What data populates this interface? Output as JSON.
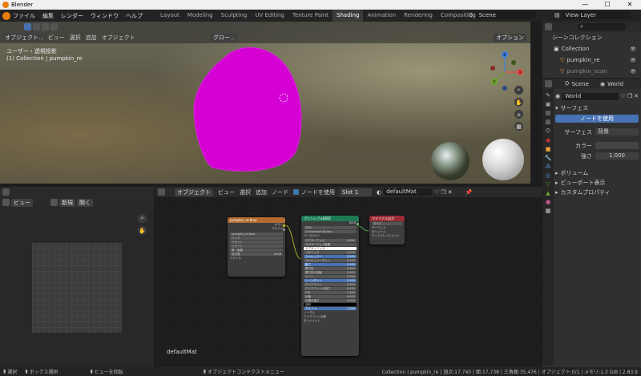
{
  "window": {
    "title": "Blender",
    "min": "—",
    "max": "☐",
    "close": "✕"
  },
  "menu": [
    "ファイル",
    "編集",
    "レンダー",
    "ウィンドウ",
    "ヘルプ"
  ],
  "workspaces": [
    {
      "label": "Layout",
      "active": false
    },
    {
      "label": "Modeling",
      "active": false
    },
    {
      "label": "Sculpting",
      "active": false
    },
    {
      "label": "UV Editing",
      "active": false
    },
    {
      "label": "Texture Paint",
      "active": false
    },
    {
      "label": "Shading",
      "active": true
    },
    {
      "label": "Animation",
      "active": false
    },
    {
      "label": "Rendering",
      "active": false
    },
    {
      "label": "Compositing",
      "active": false
    },
    {
      "label": "Scripting",
      "active": false
    }
  ],
  "scene": {
    "label": "Scene"
  },
  "view_layer": {
    "label": "View Layer"
  },
  "viewport": {
    "mode": "オブジェクト...",
    "menus": [
      "ビュー",
      "選択",
      "追加",
      "オブジェクト"
    ],
    "transform": "グロー...",
    "overlay_label": "オプション",
    "info_line1": "ユーザー・透視投影",
    "info_line2": "(1) Collection | pumpkin_re",
    "gizmo": {
      "z": "Z",
      "y": "Y",
      "x": "X"
    }
  },
  "outliner": {
    "search_placeholder": "",
    "root": "シーンコレクション",
    "items": [
      {
        "label": "Collection",
        "level": 1
      },
      {
        "label": "pumpkin_re",
        "level": 2
      },
      {
        "label": "pumpkin_scan",
        "level": 2
      }
    ]
  },
  "properties": {
    "tab_scene": "Scene",
    "tab_world": "World",
    "world_name": "World",
    "surface_header": "サーフェス",
    "use_nodes_button": "ノードを使用",
    "surface_label": "サーフェス",
    "surface_value": "背景",
    "color_label": "カラー",
    "strength_label": "強さ",
    "strength_value": "1.000",
    "sections": [
      "ボリューム",
      "ビューポート表示",
      "カスタムプロパティ"
    ]
  },
  "image_editor": {
    "view_label": "ビュー",
    "new_label": "新規",
    "open_label": "開く"
  },
  "node_editor": {
    "mode": "オブジェクト",
    "menus": [
      "ビュー",
      "選択",
      "追加",
      "ノード"
    ],
    "use_nodes": "ノードを使用",
    "slot": "Slot 1",
    "material": "defaultMat",
    "material_label": "defaultMat",
    "image_node": {
      "title": "pumpkin_re.bmp",
      "out_color": "カラー",
      "out_alpha": "アルファ",
      "image_name": "pumpkin_re.bmp",
      "rows": [
        "リニア",
        "フラット",
        "リピート",
        "単一画像"
      ],
      "colorspace_label": "色空間",
      "colorspace_value": "sRGB",
      "vector": "ベクトル"
    },
    "bsdf_node": {
      "title": "プリンシプルBSDF",
      "out": "BSDF",
      "dist": "GGX",
      "sss_method": "Christensen-Burley",
      "base_color": "ベースカラー",
      "params": [
        {
          "label": "サブサーフェス",
          "value": "0.000",
          "blue": false
        },
        {
          "label": "サブサーフェス範囲",
          "value": "",
          "blue": false
        },
        {
          "label": "サブサーフェス...",
          "value": "",
          "blue": false
        },
        {
          "label": "メタリック",
          "value": "0.000",
          "blue": false
        },
        {
          "label": "スペキュラー",
          "value": "0.500",
          "blue": true
        },
        {
          "label": "スペキュラーチント",
          "value": "0.000",
          "blue": false
        },
        {
          "label": "粗さ",
          "value": "0.500",
          "blue": true
        },
        {
          "label": "異方性",
          "value": "0.000",
          "blue": false
        },
        {
          "label": "異方性の回転",
          "value": "0.000",
          "blue": false
        },
        {
          "label": "シーン",
          "value": "0.000",
          "blue": false
        },
        {
          "label": "シーンチント",
          "value": "0.500",
          "blue": true
        },
        {
          "label": "クリアコート",
          "value": "0.000",
          "blue": false
        },
        {
          "label": "クリアコートの粗さ",
          "value": "0.030",
          "blue": false
        },
        {
          "label": "IOR",
          "value": "1.450",
          "blue": false
        },
        {
          "label": "伝播",
          "value": "0.000",
          "blue": false
        },
        {
          "label": "伝播の粗さ",
          "value": "0.000",
          "blue": false
        },
        {
          "label": "放射",
          "value": "",
          "blue": false
        },
        {
          "label": "アルファ",
          "value": "1.000",
          "blue": true
        }
      ],
      "tail": [
        "ノーマル",
        "クリアコート法線",
        "タンジェント"
      ]
    },
    "output_node": {
      "title": "マテリアル出力",
      "target": "すべて",
      "inputs": [
        "サーフェス",
        "ボリューム",
        "ディスプレイスメント"
      ]
    }
  },
  "statusbar": {
    "select": "選択",
    "box": "ボックス選択",
    "rotate": "ビューを回転",
    "context": "オブジェクトコンテクストメニュー",
    "stats": "Collection | pumpkin_re | 頂点:17,740 | 面:17,738 | 三角面:35,476 | オブジェクト:0/1 | メモリ:1.3 GiB | 2.83.9"
  },
  "colors": {
    "accent": "#4772b3",
    "pumpkin": "#d400d4",
    "bsdf_header": "#1d7a55",
    "image_header": "#b36b2f",
    "output_header": "#9c2c34"
  }
}
